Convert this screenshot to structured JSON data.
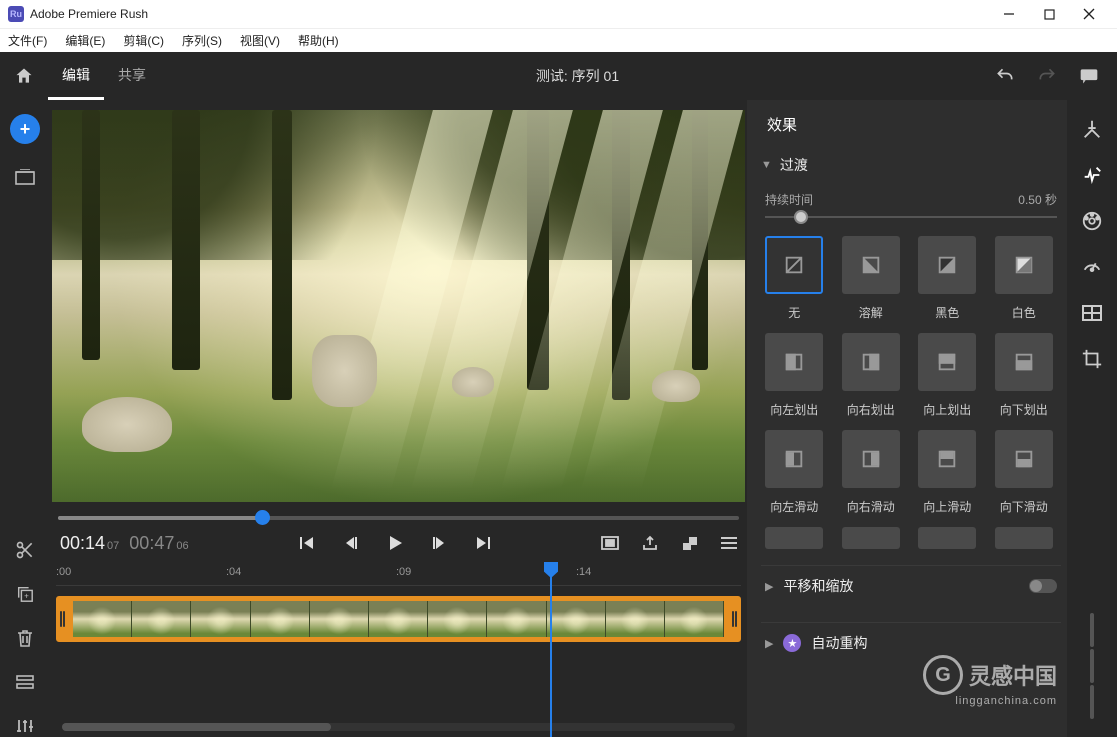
{
  "titlebar": {
    "app": "Adobe Premiere Rush",
    "logo": "Ru"
  },
  "menus": [
    "文件(F)",
    "编辑(E)",
    "剪辑(C)",
    "序列(S)",
    "视图(V)",
    "帮助(H)"
  ],
  "topbar": {
    "tabs": [
      {
        "label": "编辑",
        "active": true
      },
      {
        "label": "共享",
        "active": false
      }
    ],
    "sequence": "测试: 序列 01"
  },
  "transport": {
    "current": "00:14",
    "current_frames": "07",
    "duration": "00:47",
    "duration_frames": "06"
  },
  "timeline": {
    "ticks": [
      ":00",
      ":04",
      ":09",
      ":14"
    ]
  },
  "panel": {
    "title": "效果",
    "transition": {
      "label": "过渡",
      "duration_label": "持续时间",
      "duration_value": "0.50",
      "duration_unit": "秒"
    },
    "effects": [
      {
        "name": "无",
        "selected": true,
        "icon": "none"
      },
      {
        "name": "溶解",
        "icon": "dissolve"
      },
      {
        "name": "黑色",
        "icon": "black"
      },
      {
        "name": "白色",
        "icon": "white"
      },
      {
        "name": "向左划出",
        "icon": "wipe-l"
      },
      {
        "name": "向右划出",
        "icon": "wipe-r"
      },
      {
        "name": "向上划出",
        "icon": "wipe-u"
      },
      {
        "name": "向下划出",
        "icon": "wipe-d"
      },
      {
        "name": "向左滑动",
        "icon": "slide-l"
      },
      {
        "name": "向右滑动",
        "icon": "slide-r"
      },
      {
        "name": "向上滑动",
        "icon": "slide-u"
      },
      {
        "name": "向下滑动",
        "icon": "slide-d"
      }
    ],
    "pan_zoom": "平移和缩放",
    "auto_reframe": "自动重构"
  },
  "watermark": {
    "main": "灵感中国",
    "sub": "lingganchina.com",
    "logo": "G"
  }
}
